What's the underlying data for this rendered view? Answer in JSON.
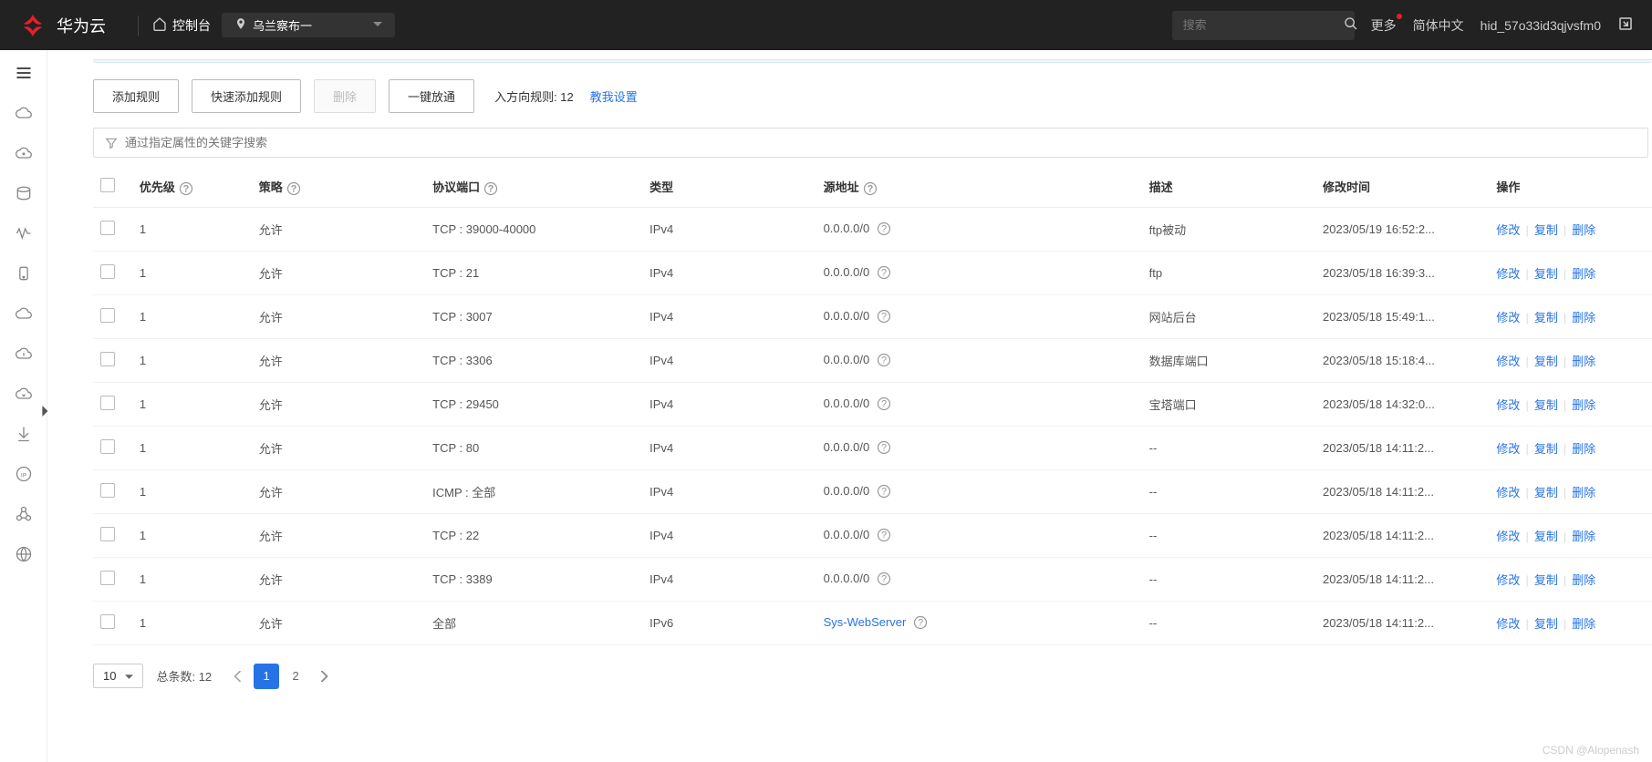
{
  "header": {
    "brand": "华为云",
    "console": "控制台",
    "region": "乌兰察布一",
    "search_placeholder": "搜索",
    "more": "更多",
    "lang": "简体中文",
    "user": "hid_57o33id3qjvsfm0"
  },
  "toolbar": {
    "add_rule": "添加规则",
    "quick_add": "快速添加规则",
    "delete": "删除",
    "open_all": "一键放通",
    "count_label": "入方向规则: 12",
    "help_link": "教我设置"
  },
  "filter": {
    "placeholder": "通过指定属性的关键字搜索"
  },
  "table": {
    "headers": {
      "priority": "优先级",
      "policy": "策略",
      "protocol": "协议端口",
      "type": "类型",
      "source": "源地址",
      "desc": "描述",
      "mtime": "修改时间",
      "ops": "操作"
    },
    "actions": {
      "edit": "修改",
      "copy": "复制",
      "delete": "删除"
    },
    "rows": [
      {
        "priority": "1",
        "policy": "允许",
        "protocol": "TCP : 39000-40000",
        "type": "IPv4",
        "source": "0.0.0.0/0",
        "source_help": true,
        "desc": "ftp被动",
        "mtime": "2023/05/19 16:52:2..."
      },
      {
        "priority": "1",
        "policy": "允许",
        "protocol": "TCP : 21",
        "type": "IPv4",
        "source": "0.0.0.0/0",
        "source_help": true,
        "desc": "ftp",
        "mtime": "2023/05/18 16:39:3..."
      },
      {
        "priority": "1",
        "policy": "允许",
        "protocol": "TCP : 3007",
        "type": "IPv4",
        "source": "0.0.0.0/0",
        "source_help": true,
        "desc": "网站后台",
        "mtime": "2023/05/18 15:49:1..."
      },
      {
        "priority": "1",
        "policy": "允许",
        "protocol": "TCP : 3306",
        "type": "IPv4",
        "source": "0.0.0.0/0",
        "source_help": true,
        "desc": "数据库端口",
        "mtime": "2023/05/18 15:18:4..."
      },
      {
        "priority": "1",
        "policy": "允许",
        "protocol": "TCP : 29450",
        "type": "IPv4",
        "source": "0.0.0.0/0",
        "source_help": true,
        "desc": "宝塔端口",
        "mtime": "2023/05/18 14:32:0..."
      },
      {
        "priority": "1",
        "policy": "允许",
        "protocol": "TCP : 80",
        "type": "IPv4",
        "source": "0.0.0.0/0",
        "source_help": true,
        "desc": "--",
        "mtime": "2023/05/18 14:11:2..."
      },
      {
        "priority": "1",
        "policy": "允许",
        "protocol": "ICMP : 全部",
        "type": "IPv4",
        "source": "0.0.0.0/0",
        "source_help": true,
        "desc": "--",
        "mtime": "2023/05/18 14:11:2..."
      },
      {
        "priority": "1",
        "policy": "允许",
        "protocol": "TCP : 22",
        "type": "IPv4",
        "source": "0.0.0.0/0",
        "source_help": true,
        "desc": "--",
        "mtime": "2023/05/18 14:11:2..."
      },
      {
        "priority": "1",
        "policy": "允许",
        "protocol": "TCP : 3389",
        "type": "IPv4",
        "source": "0.0.0.0/0",
        "source_help": true,
        "desc": "--",
        "mtime": "2023/05/18 14:11:2..."
      },
      {
        "priority": "1",
        "policy": "允许",
        "protocol": "全部",
        "type": "IPv6",
        "source": "Sys-WebServer",
        "source_link": true,
        "source_help": true,
        "desc": "--",
        "mtime": "2023/05/18 14:11:2..."
      }
    ]
  },
  "pager": {
    "page_size": "10",
    "total_label": "总条数:  12",
    "pages": [
      "1",
      "2"
    ]
  },
  "watermark": "CSDN @Alopenash"
}
